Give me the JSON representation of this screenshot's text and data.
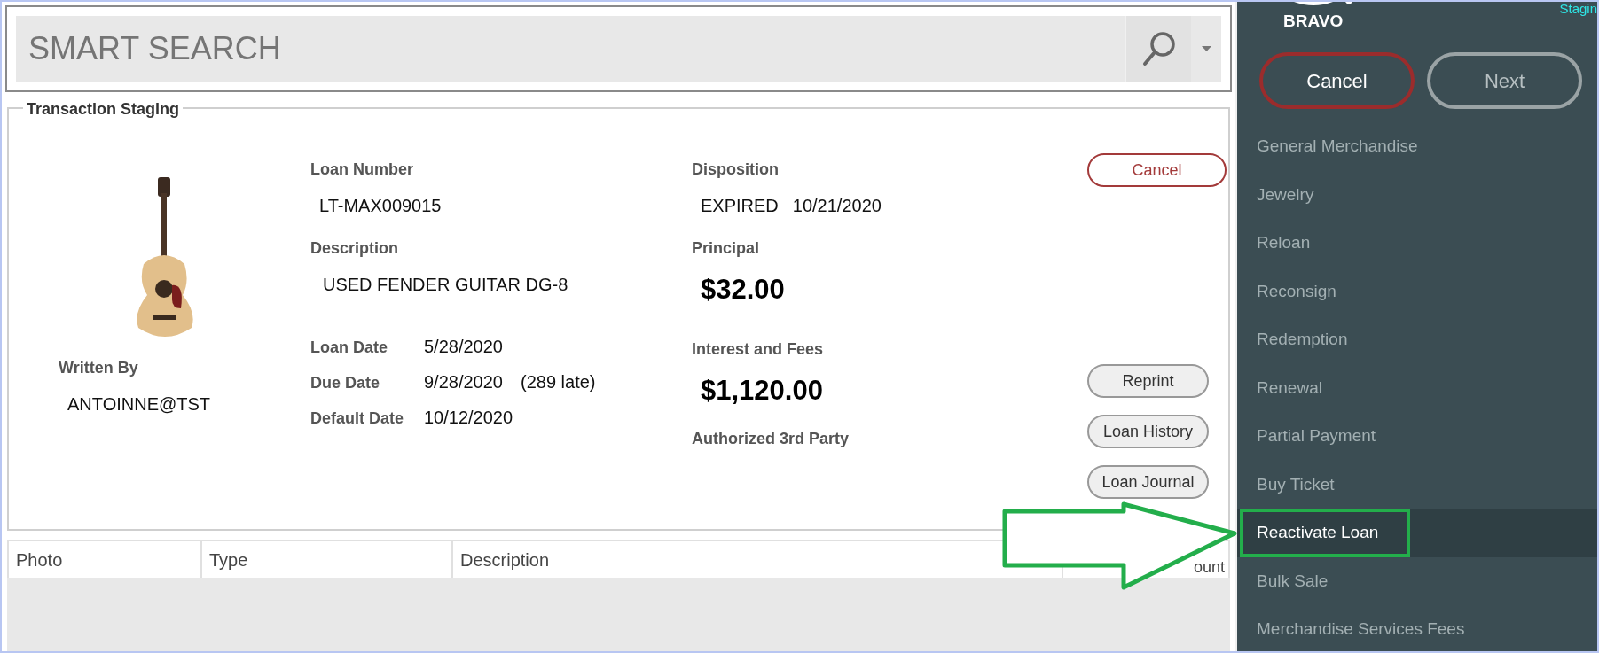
{
  "search": {
    "placeholder": "SMART SEARCH"
  },
  "staging": {
    "title": "Transaction Staging",
    "written_by": {
      "label": "Written By",
      "value": "ANTOINNE@TST"
    },
    "loan_number": {
      "label": "Loan Number",
      "value": "LT-MAX009015"
    },
    "description": {
      "label": "Description",
      "value": "USED FENDER GUITAR DG-8"
    },
    "dates": [
      {
        "label": "Loan Date",
        "value": "5/28/2020"
      },
      {
        "label": "Due Date",
        "value": "9/28/2020",
        "note": "(289 late)"
      },
      {
        "label": "Default Date",
        "value": "10/12/2020"
      }
    ],
    "disposition": {
      "label": "Disposition",
      "status": "EXPIRED",
      "date": "10/21/2020"
    },
    "principal": {
      "label": "Principal",
      "value": "$32.00"
    },
    "interest": {
      "label": "Interest and Fees",
      "value": "$1,120.00"
    },
    "third_party": {
      "label": "Authorized 3rd Party"
    },
    "cancel_button": "Cancel",
    "buttons": [
      "Reprint",
      "Loan History",
      "Loan Journal"
    ]
  },
  "table": {
    "columns": [
      "Photo",
      "Type",
      "Description",
      "ount"
    ]
  },
  "sidebar": {
    "brand": "BRAVO",
    "mode": "Stagin",
    "buttons": [
      {
        "label": "Cancel",
        "kind": "cancel"
      },
      {
        "label": "Next",
        "kind": "next"
      }
    ],
    "items": [
      {
        "label": "General Merchandise",
        "selected": false
      },
      {
        "label": "Jewelry",
        "selected": false
      },
      {
        "label": "Reloan",
        "selected": false
      },
      {
        "label": "Reconsign",
        "selected": false
      },
      {
        "label": "Redemption",
        "selected": false
      },
      {
        "label": "Renewal",
        "selected": false
      },
      {
        "label": "Partial Payment",
        "selected": false
      },
      {
        "label": "Buy Ticket",
        "selected": false
      },
      {
        "label": "Reactivate Loan",
        "selected": true
      },
      {
        "label": "Bulk Sale",
        "selected": false
      },
      {
        "label": "Merchandise Services Fees",
        "selected": false
      }
    ]
  }
}
